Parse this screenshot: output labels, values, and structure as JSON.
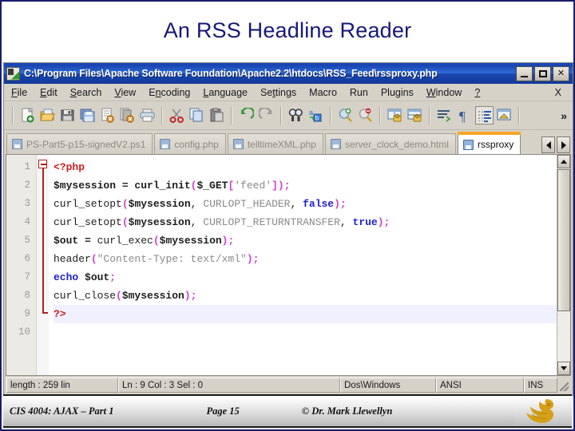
{
  "slide": {
    "title": "An RSS Headline Reader",
    "title_color": "#18187a",
    "border_color": "#1b1b6b"
  },
  "editor_window": {
    "app": "Notepad++",
    "title": "C:\\Program Files\\Apache Software Foundation\\Apache2.2\\htdocs\\RSS_Feed\\rssproxy.php",
    "window_icon": "notepad-document-icon",
    "window_buttons": [
      {
        "name": "minimize-button",
        "glyph": "_"
      },
      {
        "name": "maximize-button",
        "glyph": "□"
      },
      {
        "name": "close-button",
        "glyph": "✕"
      }
    ],
    "menu": [
      {
        "label": "File",
        "mnemonic": "F"
      },
      {
        "label": "Edit",
        "mnemonic": "E"
      },
      {
        "label": "Search",
        "mnemonic": "S"
      },
      {
        "label": "View",
        "mnemonic": "V"
      },
      {
        "label": "Encoding",
        "mnemonic": "n"
      },
      {
        "label": "Language",
        "mnemonic": "L"
      },
      {
        "label": "Settings",
        "mnemonic": "t"
      },
      {
        "label": "Macro",
        "mnemonic": "M"
      },
      {
        "label": "Run",
        "mnemonic": "R"
      },
      {
        "label": "Plugins",
        "mnemonic": "P"
      },
      {
        "label": "Window",
        "mnemonic": "W"
      },
      {
        "label": "?",
        "mnemonic": "?"
      }
    ],
    "menu_close_label": "X",
    "toolbar": {
      "overflow_label": "»",
      "buttons": [
        "new-file-icon",
        "open-file-icon",
        "save-icon",
        "save-all-icon",
        "close-file-icon",
        "close-all-icon",
        "print-icon",
        "cut-icon",
        "copy-icon",
        "paste-icon",
        "undo-icon",
        "redo-icon",
        "find-icon",
        "replace-icon",
        "zoom-in-icon",
        "zoom-out-icon",
        "sync-vertical-scroll-icon",
        "sync-horizontal-scroll-icon",
        "word-wrap-icon",
        "show-all-characters-icon",
        "indent-guideline-icon",
        "user-defined-dialog-icon"
      ]
    },
    "tabs": [
      {
        "label": "PS-Part5-p15-signedV2.ps1",
        "active": false
      },
      {
        "label": "config.php",
        "active": false
      },
      {
        "label": "telltimeXML.php",
        "active": false
      },
      {
        "label": "server_clock_demo.html",
        "active": false
      },
      {
        "label": "rssproxy",
        "active": true
      }
    ],
    "tab_nav": {
      "prev": "scroll-tabs-left",
      "next": "scroll-tabs-right"
    },
    "gutter_lines": [
      "1",
      "2",
      "3",
      "4",
      "5",
      "6",
      "7",
      "8",
      "9",
      "10"
    ],
    "code_lines": [
      "<?php",
      "$mysession = curl_init($_GET['feed']);",
      "curl_setopt($mysession, CURLOPT_HEADER, false);",
      "curl_setopt($mysession, CURLOPT_RETURNTRANSFER, true);",
      "$out = curl_exec($mysession);",
      "header(\"Content-Type: text/xml\");",
      "echo $out;",
      "curl_close($mysession);",
      "?>",
      ""
    ],
    "status_bar": {
      "length": "length : 259    lin",
      "position": "Ln : 9    Col : 3    Sel : 0",
      "eol": "Dos\\Windows",
      "encoding": "ANSI",
      "insert_mode": "INS"
    }
  },
  "footer": {
    "course": "CIS 4004: AJAX – Part 1",
    "page": "Page 15",
    "copyright": "© Dr. Mark Llewellyn",
    "logo": "ucf-pegasus-logo"
  }
}
